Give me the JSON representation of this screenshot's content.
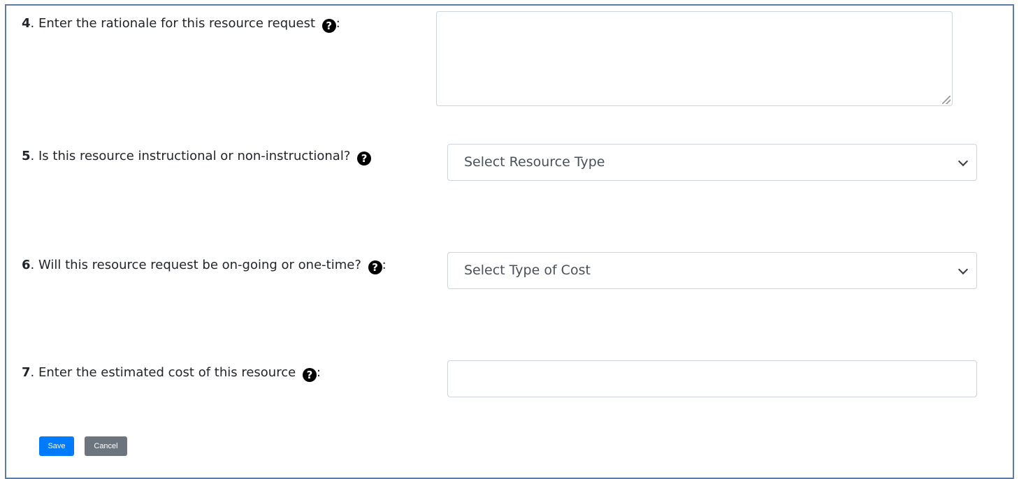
{
  "form": {
    "q4": {
      "number": "4",
      "text": ". Enter the rationale for this resource request",
      "suffix": ":",
      "help_icon": "question-circle-icon",
      "value": ""
    },
    "q5": {
      "number": "5",
      "text": ". Is this resource instructional or non-instructional?",
      "suffix": "",
      "help_icon": "question-circle-icon",
      "selected": "Select Resource Type"
    },
    "q6": {
      "number": "6",
      "text": ". Will this resource request be on-going or one-time?",
      "suffix": ":",
      "help_icon": "question-circle-icon",
      "selected": "Select Type of Cost"
    },
    "q7": {
      "number": "7",
      "text": ". Enter the estimated cost of this resource",
      "suffix": ":",
      "help_icon": "question-circle-icon",
      "value": ""
    },
    "help_glyph": "?"
  },
  "buttons": {
    "save_label": "Save",
    "cancel_label": "Cancel"
  },
  "colors": {
    "frame_border": "#5b7ba8",
    "save_button": "#007bff",
    "cancel_button": "#6c757d"
  }
}
